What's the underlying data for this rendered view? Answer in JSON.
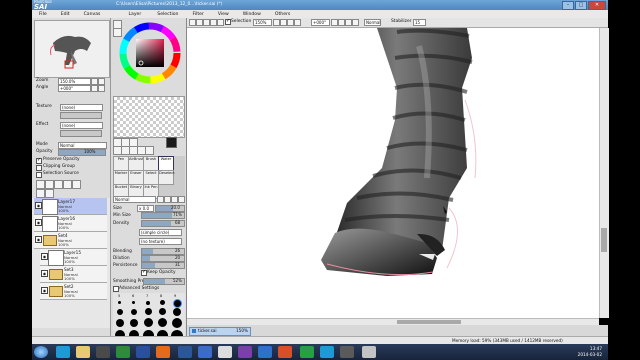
{
  "window": {
    "logo_text": "PaintTool",
    "app_name": "SAI",
    "title": "C:\\Users\\Elisa\\Pictures\\2013_12_0...\\ticker.sai (*)",
    "minimize": "–",
    "maximize": "□",
    "close": "✕"
  },
  "menu": [
    "File",
    "Edit",
    "Canvas",
    "Layer",
    "Selection",
    "Filter",
    "View",
    "Window",
    "Others"
  ],
  "canvas_toolbar": {
    "selection_label": "Selection",
    "zoom": "150%",
    "angle": "+000°",
    "blend_mode": "Normal",
    "stabilizer_label": "Stabilizer",
    "stabilizer_value": "15"
  },
  "navigator": {
    "zoom_label": "Zoom",
    "zoom_value": "150.0%",
    "angle_label": "Angle",
    "angle_value": "+000°"
  },
  "layer_props": {
    "texture_label": "Texture",
    "texture_value": "(none)",
    "effect_label": "Effect",
    "effect_value": "(none)",
    "mode_label": "Mode",
    "mode_value": "Normal",
    "opacity_label": "Opacity",
    "opacity_value": "100%",
    "preserve_opacity": "Preserve Opacity",
    "clipping_group": "Clipping Group",
    "selection_source": "Selection Source"
  },
  "layers": [
    {
      "name": "Layer17",
      "mode": "Normal",
      "opacity": "100%",
      "kind": "layer",
      "selected": true
    },
    {
      "name": "Layer16",
      "mode": "Normal",
      "opacity": "100%",
      "kind": "layer",
      "selected": false
    },
    {
      "name": "Set4",
      "mode": "Normal",
      "opacity": "100%",
      "kind": "folder",
      "selected": false
    },
    {
      "name": "Layer15",
      "mode": "Normal",
      "opacity": "100%",
      "kind": "layer",
      "selected": false
    },
    {
      "name": "Set3",
      "mode": "Normal",
      "opacity": "100%",
      "kind": "folder",
      "selected": false
    },
    {
      "name": "Set2",
      "mode": "Normal",
      "opacity": "100%",
      "kind": "folder",
      "selected": false
    }
  ],
  "brushes": [
    [
      "Pen",
      "AirBrush",
      "Brush",
      "Water"
    ],
    [
      "Marker",
      "Eraser",
      "Select",
      "Deselect"
    ],
    [
      "Bucket",
      "Binary",
      "Ink Pen",
      ""
    ]
  ],
  "brush_settings": {
    "mode_value": "Normal",
    "size_label": "Size",
    "size_mult": "x 0.0",
    "size_value": "20.0",
    "min_size_label": "Min Size",
    "min_size_value": "71%",
    "density_label": "Density",
    "density_value": "68",
    "shape_value": "(simple circle)",
    "texture_value": "(no texture)",
    "blending_label": "Blending",
    "blending_value": "26",
    "dilution_label": "Dilution",
    "dilution_value": "20",
    "persistence_label": "Persistence",
    "persistence_value": "31",
    "keep_opacity": "Keep Opacity",
    "smoothing_label": "Smoothing Pre",
    "smoothing_value": "52%",
    "advanced": "Advanced Settings"
  },
  "brush_size_labels": [
    "5",
    "6",
    "7",
    "8",
    "9"
  ],
  "document": {
    "name": "ticker.sai",
    "zoom": "150%"
  },
  "status": {
    "memory": "Memory load: 59% (343MB used / 1412MB reserved)"
  },
  "taskbar": {
    "time": "13:47",
    "date": "2014-03-02"
  },
  "colors": {
    "titlebar": "#4e86bf",
    "selected_layer": "#b7c4ef",
    "taskbar": "#17243b"
  }
}
